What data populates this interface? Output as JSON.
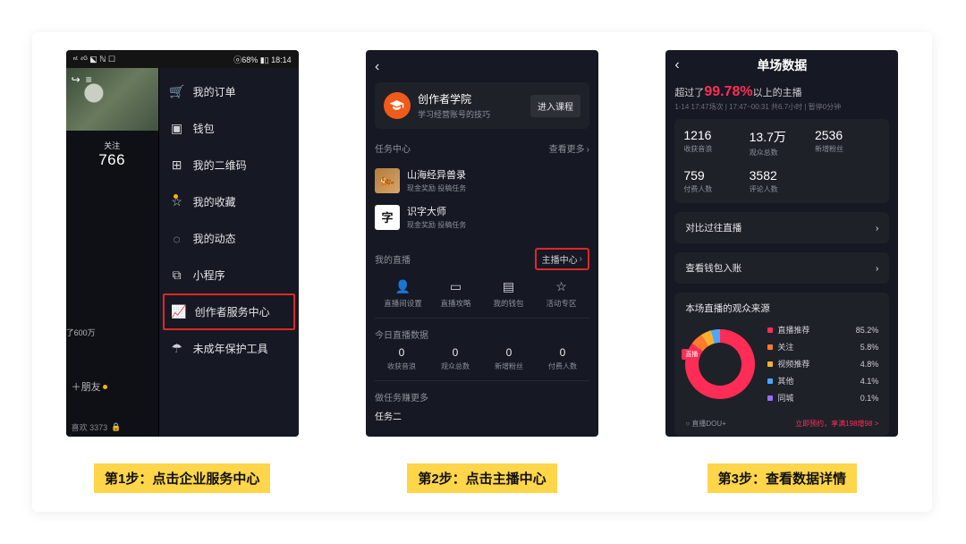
{
  "step_labels": {
    "s1": "第1步：点击企业服务中心",
    "s2": "第2步：点击主播中心",
    "s3": "第3步：查看数据详情"
  },
  "phone1": {
    "status_left": "ⁿᵗ ⁴ᴳ ⬕ ℕ ☐",
    "status_right": "ⓞ68% ▮▯ 18:14",
    "follow_label": "关注",
    "follow_value": "766",
    "edge_text": "了600万",
    "add_friend": "＋朋友",
    "likes": "喜欢 3373",
    "menu": {
      "orders": "我的订单",
      "wallet": "钱包",
      "qrcode": "我的二维码",
      "favorites": "我的收藏",
      "moments": "我的动态",
      "miniapp": "小程序",
      "creator": "创作者服务中心",
      "minor": "未成年保护工具"
    }
  },
  "phone2": {
    "academy_title": "创作者学院",
    "academy_sub": "学习经营账号的技巧",
    "enter_course": "进入课程",
    "task_center": "任务中心",
    "see_more": "查看更多",
    "task1_title": "山海经异兽录",
    "task1_sub": "现金奖励  投稿任务",
    "task2_title": "识字大师",
    "task2_sub": "现金奖励  投稿任务",
    "my_live": "我的直播",
    "live_center": "主播中心",
    "mylive": {
      "c1": "直播间设置",
      "c2": "直播攻略",
      "c3": "我的钱包",
      "c4": "活动专区"
    },
    "today_head": "今日直播数据",
    "today": {
      "c1_lab": "收获音浪",
      "c2_lab": "观众总数",
      "c3_lab": "新增粉丝",
      "c4_lab": "付费人数",
      "c1_val": "0",
      "c2_val": "0",
      "c3_val": "0",
      "c4_val": "0"
    },
    "more_need": "做任务赚更多",
    "task_two": "任务二"
  },
  "phone3": {
    "title": "单场数据",
    "surpass_pre": "超过了",
    "surpass_pct": "99.78%",
    "surpass_post": "以上的主播",
    "time_line": "1-14 17:47场次 | 17:47~00:31 共6.7小时 | 暂停0分钟",
    "stats": {
      "s1_v": "1216",
      "s1_l": "收获音浪",
      "s2_v": "13.7万",
      "s2_l": "观众总数",
      "s3_v": "2536",
      "s3_l": "新增粉丝",
      "s4_v": "759",
      "s4_l": "付费人数",
      "s5_v": "3582",
      "s5_l": "评论人数"
    },
    "link1": "对比过往直播",
    "link2": "查看钱包入账",
    "src_title": "本场直播的观众来源",
    "donut_label": "直播",
    "legend": {
      "r1_k": "直播推荐",
      "r1_v": "85.2%",
      "r2_k": "关注",
      "r2_v": "5.8%",
      "r3_k": "视频推荐",
      "r3_v": "4.8%",
      "r4_k": "其他",
      "r4_v": "4.1%",
      "r5_k": "同城",
      "r5_v": "0.1%"
    },
    "dou_left": "○ 直播DOU+",
    "dou_right": "立即预约，享满198增98 >"
  }
}
